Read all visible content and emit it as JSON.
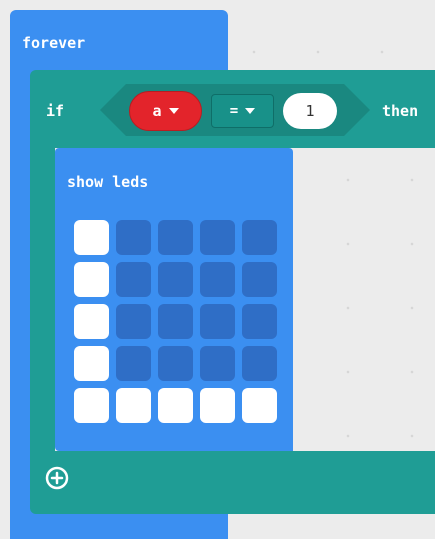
{
  "forever": {
    "label": "forever"
  },
  "if_block": {
    "if_label": "if",
    "then_label": "then",
    "variable": "a",
    "operator": "=",
    "value": "1"
  },
  "show_leds": {
    "label": "show leds",
    "grid": [
      [
        1,
        0,
        0,
        0,
        0
      ],
      [
        1,
        0,
        0,
        0,
        0
      ],
      [
        1,
        0,
        0,
        0,
        0
      ],
      [
        1,
        0,
        0,
        0,
        0
      ],
      [
        1,
        1,
        1,
        1,
        1
      ]
    ]
  },
  "colors": {
    "loops_blue": "#3b8ff1",
    "logic_teal": "#1f9d95",
    "variable_red": "#e3242b",
    "led_off": "#2f6ec6",
    "led_on": "#ffffff",
    "canvas": "#ececec"
  },
  "icons": {
    "add": "plus-circle-icon",
    "dropdown": "caret-down-icon"
  }
}
